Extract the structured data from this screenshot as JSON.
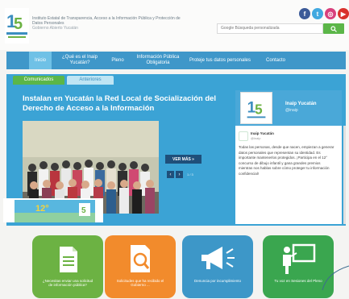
{
  "header": {
    "institution": "Instituto Estatal de Transparencia, Acceso a la Información Pública y Protección de Datos Personales",
    "subtitle": "Gobierno Abierto Yucatán",
    "search_placeholder": "Google Búsqueda personalizada"
  },
  "nav": {
    "items": [
      {
        "label": "Inicio"
      },
      {
        "label": "¿Qué es el Inaip Yucatán?"
      },
      {
        "label": "Pleno"
      },
      {
        "label": "Información Pública Obligatoria"
      },
      {
        "label": "Proteje tus datos personales"
      },
      {
        "label": "Contacto"
      }
    ]
  },
  "tabs": [
    "Comunicados",
    "Anteriores"
  ],
  "news": {
    "title": "Instalan en Yucatán la Red Local de Socialización del Derecho de Acceso a la Información",
    "more_label": "VER MÁS »",
    "counter": "1 / 3"
  },
  "twitter": {
    "account_name": "Inaip Yucatán",
    "handle": "@inaip",
    "post_name": "Inaip Yucatán",
    "post_handle": "@inaip",
    "post_text": "Todas las personas, desde que nacen, empiezan a generar datos personales que representan su identidad. Es importante mantenerlos protegidos. ¡Participa en el 12° concurso de dibujo infantil y gana grandes premios mientras nos hablas sobre cómo proteger tu información confidencial!",
    "image_text": "12°"
  },
  "tiles": [
    {
      "label": "¿Necesitas enviar una solicitud de información pública?",
      "color": "#6cb243"
    },
    {
      "label": "Solicitudes que ha recibido el Gobierno ...",
      "color": "#f28b2c"
    },
    {
      "label": "Denuncia por incumplimiento",
      "color": "#3d97c8"
    },
    {
      "label": "Tu voz en Sesiones del Pleno",
      "color": "#3aa64f"
    }
  ],
  "colors": {
    "nav": "#3f97c9",
    "panel": "#3ba3d5",
    "accent_green": "#5bb648"
  },
  "icons": {
    "social": [
      "facebook-icon",
      "twitter-icon",
      "instagram-icon",
      "youtube-icon"
    ],
    "tiles": [
      "document-icon",
      "magnifier-document-icon",
      "megaphone-icon",
      "presenter-board-icon"
    ]
  }
}
